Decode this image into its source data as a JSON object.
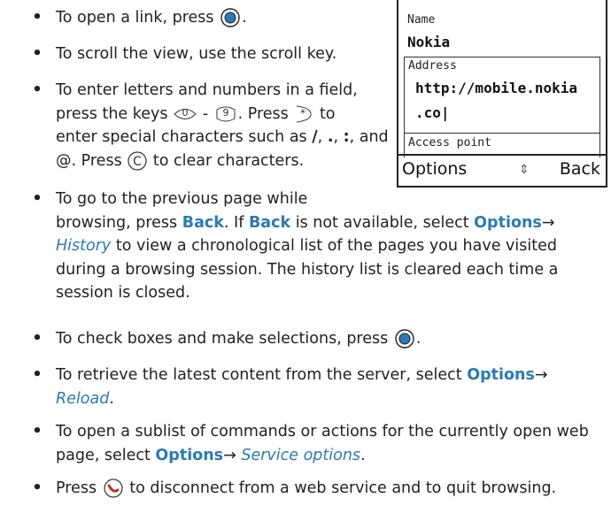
{
  "phone": {
    "name_label": "Name",
    "name_value": "Nokia",
    "address_label": "Address",
    "address_value_1": "http://mobile.nokia",
    "address_value_2": ".co|",
    "access_point_label": "Access point",
    "soft_left": "Options",
    "soft_mid": "⇕",
    "soft_right": "Back"
  },
  "items": [
    {
      "a": "To open a link, press",
      "b": "."
    },
    {
      "a": "To scroll the view, use the scroll key."
    },
    {
      "l1": "To enter letters and numbers in a field,",
      "l2a": "press the keys",
      "l2b": "-",
      "l2c": ". Press",
      "l2d": "to",
      "l3a": "enter special characters such as",
      "s1": "/",
      "s2": ".",
      "s3": ":",
      "l3b": ", and",
      "l4a": "@. Press",
      "l4b": "to clear characters."
    },
    {
      "l1": "To go to the previous page while",
      "l2a": "browsing, press",
      "back1": "Back",
      "l2b": ". If",
      "back2": "Back",
      "l2c": "is not available, select",
      "opt": "Options",
      "arrow": "→",
      "hist": "History",
      "l3b": "to view a chronological list of the pages you have visited",
      "l4": "during a browsing session. The history list is cleared each time a",
      "l5": "session is closed."
    },
    {
      "a": "To check boxes and make selections, press",
      "b": "."
    },
    {
      "a": "To retrieve the latest content from the server, select",
      "opt": "Options",
      "arrow": "→",
      "reload": "Reload",
      "end": "."
    },
    {
      "l1": "To open a sublist of commands or actions for the currently open web",
      "l2a": "page, select",
      "opt": "Options",
      "arrow": "→",
      "svc": "Service options",
      "end": "."
    },
    {
      "a": "Press",
      "b": "to disconnect from a web service and to quit browsing."
    }
  ],
  "bullet": "•"
}
